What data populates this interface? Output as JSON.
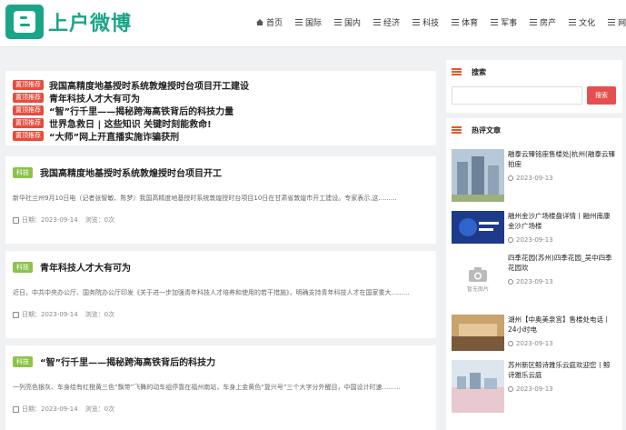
{
  "site": {
    "logo_text": "上户微博"
  },
  "nav": [
    {
      "label": "首页",
      "icon": "home-icon"
    },
    {
      "label": "国际",
      "icon": "list-icon"
    },
    {
      "label": "国内",
      "icon": "list-icon"
    },
    {
      "label": "经济",
      "icon": "list-icon"
    },
    {
      "label": "科技",
      "icon": "list-icon"
    },
    {
      "label": "体育",
      "icon": "list-icon"
    },
    {
      "label": "军事",
      "icon": "list-icon"
    },
    {
      "label": "房产",
      "icon": "list-icon"
    },
    {
      "label": "文化",
      "icon": "list-icon"
    },
    {
      "label": "网络",
      "icon": "list-icon"
    }
  ],
  "headlines": {
    "tag": "置顶推荐",
    "items": [
      "我国高精度地基授时系统敦煌授时台项目开工建设",
      "青年科技人才大有可为",
      "“智”行千里——揭秘跨海高铁背后的科技力量",
      "世界急救日 | 这些知识 关键时刻能救命!",
      "“大师”网上开直播实施诈骗获刑"
    ]
  },
  "articles": [
    {
      "tag": "科技",
      "title": "我国高精度地基授时系统敦煌授时台项目开工",
      "body": "新华社兰州9月10日电（记者张智敏、陈梦）我国高精度地基授时系统敦煌授时台项目10日在甘肃省敦煌市开工建设。专家表示,这.........",
      "date": "日期：2023-09-14",
      "views": "浏览：0次"
    },
    {
      "tag": "科技",
      "title": "青年科技人才大有可为",
      "body": "近日，中共中央办公厅、国务院办公厅印发《关于进一步加强青年科技人才培养和使用的若干措施》，明确支持青年科技人才在国家重大.........",
      "date": "日期：2023-09-14",
      "views": "浏览：0次"
    },
    {
      "tag": "科技",
      "title": "“智”行千里——揭秘跨海高铁背后的科技力",
      "body": "一列亮色银灰、车身绘有红橙黄三色“飘带”飞舞的动车组停靠在福州南站，车身上金黄色“复兴号”三个大字分外醒目，中国设计时速.........",
      "date": "日期：2023-09-14",
      "views": "浏览：0次"
    }
  ],
  "sidebar": {
    "search_title": "搜索",
    "search_button": "搜索",
    "search_placeholder": "",
    "hot_title": "热评文章",
    "hot": [
      {
        "title": "融泰云臻铭座售楼处|杭州(融泰云臻拍座",
        "date": "2023-09-13"
      },
      {
        "title": "融州金沙广场楼盘详情丨融州南康金沙广场楼",
        "date": "2023-09-13"
      },
      {
        "title": "四季花园(苏州)四季花园_吴中四季花园欢",
        "date": "2023-09-13"
      },
      {
        "title": "湖州【中奥美泉宫】售楼处电话丨24小时电",
        "date": "2023-09-13"
      },
      {
        "title": "苏州新区鲸诗雅乐云庭欢迎您丨鲸诗雅乐云庭",
        "date": "2023-09-13"
      }
    ],
    "placeholder_thumb_text": "暂无图片"
  },
  "colors": {
    "brand": "#1aa589",
    "hot_tag": "#e74c3c",
    "tech_tag": "#8cc34a",
    "search_button": "#e54f4f",
    "side_icon": "#e8582b"
  }
}
